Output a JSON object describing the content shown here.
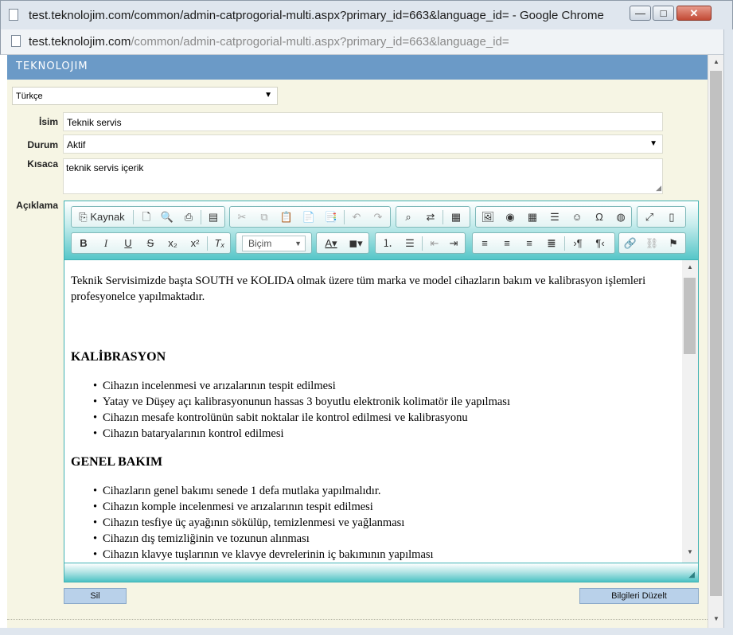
{
  "window": {
    "title": "test.teknolojim.com/common/admin-catprogorial-multi.aspx?primary_id=663&language_id= - Google Chrome",
    "minimize_glyph": "—",
    "maximize_glyph": "□",
    "close_glyph": "✕"
  },
  "address_bar": {
    "host": "test.teknolojim.com",
    "path": "/common/admin-catprogorial-multi.aspx?primary_id=663&language_id="
  },
  "brand": {
    "logo_text": "TEKNOLOJIM"
  },
  "form": {
    "language_select": "Türkçe",
    "name_label": "İsim",
    "name_value": "Teknik servis",
    "status_label": "Durum",
    "status_value": "Aktif",
    "summary_label": "Kısaca",
    "summary_value": "teknik servis içerik",
    "description_label": "Açıklama",
    "delete_button": "Sil",
    "save_button": "Bilgileri Düzelt"
  },
  "toolbar": {
    "source_label": "Kaynak",
    "format_combo": "Biçim"
  },
  "content": {
    "intro": "Teknik Servisimizde başta SOUTH ve KOLIDA olmak üzere tüm marka ve model cihazların bakım ve kalibrasyon işlemleri profesyonelce yapılmaktadır.",
    "heading1": "KALİBRASYON",
    "list1": [
      "Cihazın incelenmesi ve arızalarının tespit edilmesi",
      "Yatay ve Düşey açı kalibrasyonunun hassas 3 boyutlu elektronik kolimatör ile yapılması",
      "Cihazın mesafe kontrolünün sabit noktalar ile kontrol edilmesi ve kalibrasyonu",
      "Cihazın bataryalarının kontrol edilmesi"
    ],
    "heading2": "GENEL BAKIM",
    "list2": [
      "Cihazların genel bakımı senede 1 defa mutlaka yapılmalıdır.",
      "Cihazın komple incelenmesi ve arızalarının tespit edilmesi",
      "Cihazın tesfiye üç ayağının sökülüp, temizlenmesi ve yağlanması",
      "Cihazın dış temizliğinin ve tozunun alınması",
      "Cihazın klavye tuşlarının ve klavye devrelerinin iç bakımının yapılması"
    ]
  }
}
